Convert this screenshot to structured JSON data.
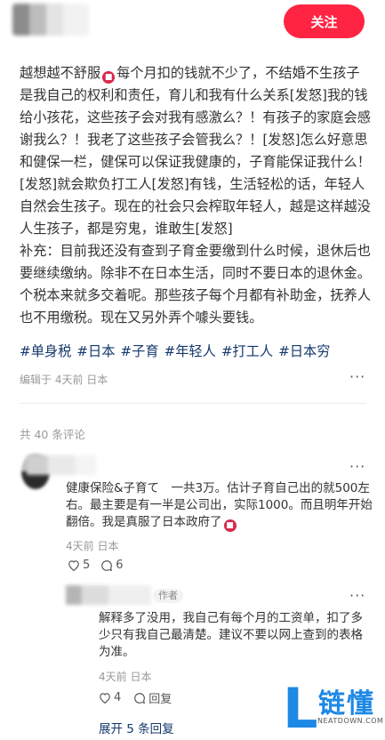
{
  "header": {
    "follow_label": "关注"
  },
  "post": {
    "line_a": "越想越不舒服",
    "line_b": "每个月扣的钱就不少了，不结婚不生孩子是我自己的权利和责任，育儿和我有什么关系[发怒]我的钱给小孩花，这些孩子会对我有感激么？！有孩子的家庭会感谢我么？！我老了这些孩子会管我么？！[发怒]怎么好意思和健保一栏，健保可以保证我健康的，子育能保证我什么！[发怒]就会欺负打工人[发怒]有钱，生活轻松的话，年轻人自然会生孩子。现在的社会只会榨取年轻人，越是这样越没人生孩子，都是穷鬼，谁敢生[发怒]\n补充：目前我还没有查到子育金要缴到什么时候，退休后也要继续缴纳。除非不在日本生活，同时不要日本的退休金。个税本来就多交着呢。那些孩子每个月都有补助金，抚养人也不用缴税。现在又另外弄个噱头要钱。",
    "tags": [
      "#单身税",
      "#日本",
      "#子育",
      "#年轻人",
      "#打工人",
      "#日本穷"
    ],
    "meta": "编辑于 4天前 日本"
  },
  "comments": {
    "count_label": "共 40 条评论",
    "first": {
      "text": "健康保险&子育て　一共3万。估计子育自己出的就500左右。最主要是有一半是公司出，实际1000。而且明年开始翻倍。我是真服了日本政府了",
      "time": "4天前 日本",
      "likes": "5",
      "replies": "6"
    },
    "reply": {
      "badge": "作者",
      "text": "解释多了没用，我自己有每个月的工资单，扣了多少只有我自己最清楚。建议不要以网上查到的表格为准。",
      "time": "4天前 日本",
      "likes": "4",
      "reply_label": "回复"
    },
    "expand_label": "展开 5 条回复"
  },
  "watermark": {
    "text": "链懂",
    "sub": "NEATDOWN.COM",
    "letter": "L"
  },
  "colors": {
    "accent": "#ff2442",
    "tag": "#13386c",
    "watermark": "#1e88e5"
  },
  "icons": [
    "more-icon",
    "heart-icon",
    "comment-icon",
    "angry-emoji-icon"
  ]
}
